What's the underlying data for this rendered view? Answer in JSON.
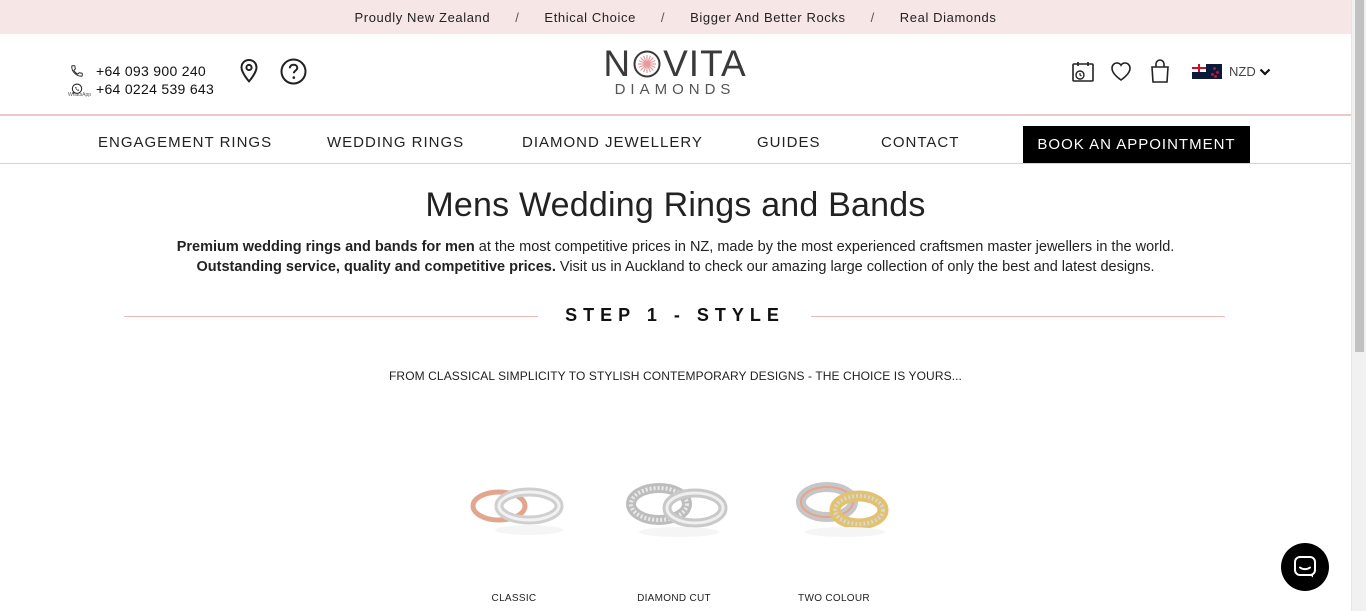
{
  "topbar": {
    "items": [
      "Proudly New Zealand",
      "Ethical Choice",
      "Bigger And Better Rocks",
      "Real Diamonds"
    ],
    "separator": "/"
  },
  "header": {
    "phone": "+64 093 900 240",
    "whatsapp": "+64 0224 539 643",
    "whatsapp_label": "WhatsApp",
    "logo_top": "N VITA",
    "logo_top_left": "N",
    "logo_top_right": "VITA",
    "logo_bottom": "DIAMONDS",
    "currency": "NZD",
    "icons": [
      "phone-icon",
      "whatsapp-icon",
      "location-pin-icon",
      "help-icon",
      "appointment-icon",
      "wishlist-heart-icon",
      "shopping-bag-icon",
      "nz-flag-icon",
      "chevron-down-icon"
    ]
  },
  "nav": {
    "items": [
      "ENGAGEMENT RINGS",
      "WEDDING RINGS",
      "DIAMOND JEWELLERY",
      "GUIDES",
      "CONTACT"
    ],
    "cta": "BOOK AN APPOINTMENT"
  },
  "main": {
    "title": "Mens Wedding Rings and Bands",
    "intro_line1_bold": "Premium wedding rings and bands for men",
    "intro_line1_rest": " at the most competitive prices in NZ, made by the most experienced craftsmen master jewellers in the world.",
    "intro_line2_bold": "Outstanding service, quality and competitive prices.",
    "intro_line2_rest": " Visit us in Auckland to check our amazing large collection of only the best and latest designs.",
    "step_label": "STEP 1 - STYLE",
    "subtitle": "FROM CLASSICAL SIMPLICITY TO STYLISH CONTEMPORARY DESIGNS - THE CHOICE IS YOURS...",
    "styles": [
      {
        "name": "CLASSIC"
      },
      {
        "name": "DIAMOND CUT"
      },
      {
        "name": "TWO COLOUR"
      }
    ]
  },
  "colors": {
    "topbar_bg": "#f7e6e6",
    "accent_line": "#ecc9c9",
    "cta_bg": "#000000",
    "rose_gold": "#e8a894",
    "white_gold": "#d8d8d8",
    "yellow_gold": "#e3c26f"
  },
  "chat": {
    "icon": "chat-icon"
  }
}
